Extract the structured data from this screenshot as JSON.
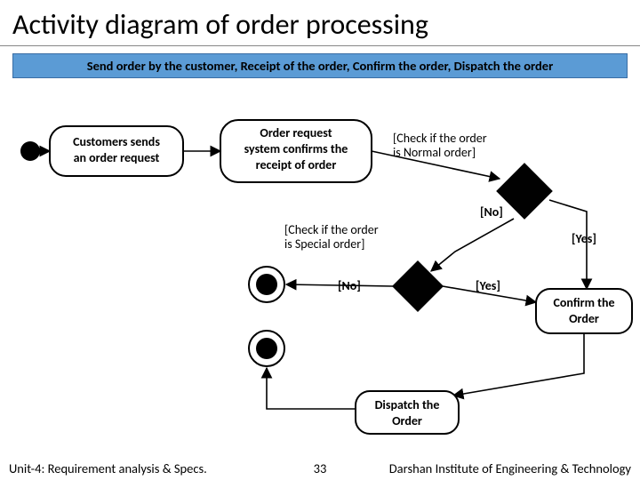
{
  "title": "Activity diagram of order processing",
  "banner": "Send order by the customer, Receipt of the order, Confirm the order, Dispatch the order",
  "nodes": {
    "a1": {
      "l1": "Customers sends",
      "l2": "an order request"
    },
    "a2": {
      "l1": "Order request",
      "l2": "system confirms the",
      "l3": "receipt of order"
    },
    "a3": {
      "l1": "Confirm the",
      "l2": "Order"
    },
    "a4": {
      "l1": "Dispatch the",
      "l2": "Order"
    }
  },
  "guards": {
    "normal": {
      "l1": "[Check if the order",
      "l2": "is Normal order]"
    },
    "special": {
      "l1": "[Check if the order",
      "l2": "is Special order]"
    },
    "yes": "[Yes]",
    "no": "[No]"
  },
  "footer": {
    "left": "Unit-4: Requirement analysis & Specs.",
    "page": "33",
    "right": "Darshan Institute of Engineering & Technology"
  }
}
